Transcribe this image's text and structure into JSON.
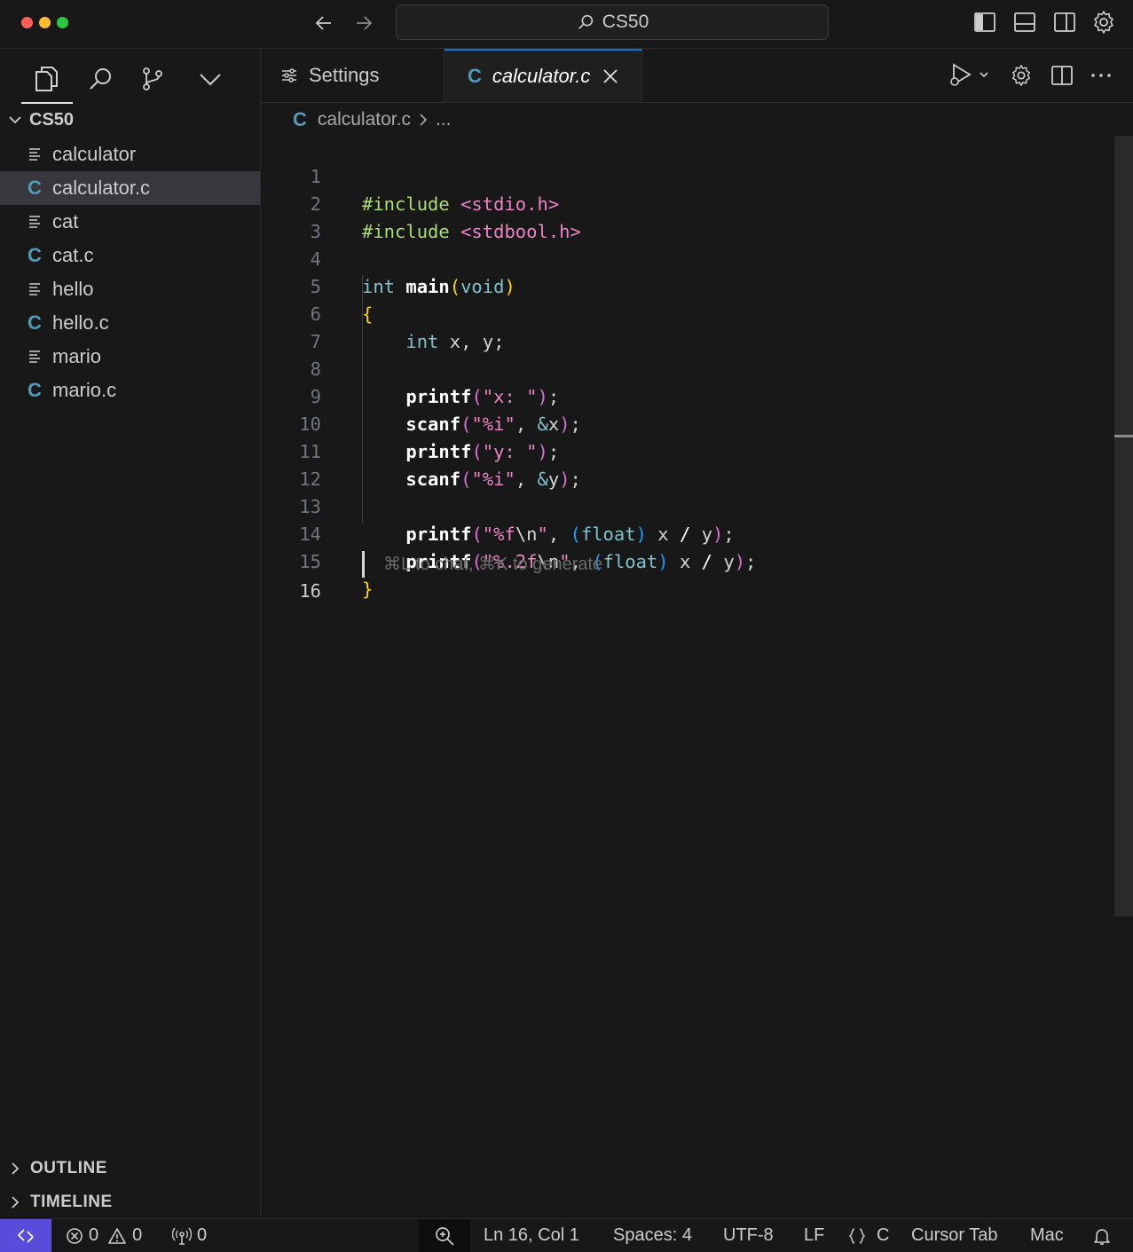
{
  "titlebar": {
    "search_text": "CS50",
    "traffic_lights": {
      "close": "#ff5f57",
      "minimize": "#febc2e",
      "maximize": "#28c840"
    }
  },
  "sidebar": {
    "folder_name": "CS50",
    "files": [
      {
        "name": "calculator",
        "icon": "text-lines-icon"
      },
      {
        "name": "calculator.c",
        "icon": "c-file-icon",
        "selected": true
      },
      {
        "name": "cat",
        "icon": "text-lines-icon"
      },
      {
        "name": "cat.c",
        "icon": "c-file-icon"
      },
      {
        "name": "hello",
        "icon": "text-lines-icon"
      },
      {
        "name": "hello.c",
        "icon": "c-file-icon"
      },
      {
        "name": "mario",
        "icon": "text-lines-icon"
      },
      {
        "name": "mario.c",
        "icon": "c-file-icon"
      }
    ],
    "c_icon_glyph": "C",
    "outline_label": "OUTLINE",
    "timeline_label": "TIMELINE"
  },
  "tabs": {
    "settings_label": "Settings",
    "active_label": "calculator.c",
    "active_icon_glyph": "C"
  },
  "breadcrumb": {
    "icon_glyph": "C",
    "file": "calculator.c",
    "more": "..."
  },
  "editor": {
    "line_numbers": [
      "1",
      "2",
      "3",
      "4",
      "5",
      "6",
      "7",
      "8",
      "9",
      "10",
      "11",
      "12",
      "13",
      "14",
      "15",
      "16"
    ],
    "active_line": "16",
    "lines": [
      "#include <stdio.h>",
      "#include <stdbool.h>",
      "",
      "int main(void)",
      "{",
      "    int x, y;",
      "",
      "    printf(\"x: \");",
      "    scanf(\"%i\", &x);",
      "    printf(\"y: \");",
      "    scanf(\"%i\", &y);",
      "",
      "    printf(\"%f\\n\", (float) x / y);",
      "    printf(\"%.2f\\n\", (float) x / y);",
      "}",
      ""
    ],
    "hint": "⌘L to chat, ⌘K to generate"
  },
  "statusbar": {
    "errors": "0",
    "warnings": "0",
    "ports": "0",
    "position": "Ln 16, Col 1",
    "spaces": "Spaces: 4",
    "encoding": "UTF-8",
    "eol": "LF",
    "language": "C",
    "cursor_tab": "Cursor Tab",
    "platform": "Mac",
    "remote_color": "#5a4cdb"
  }
}
